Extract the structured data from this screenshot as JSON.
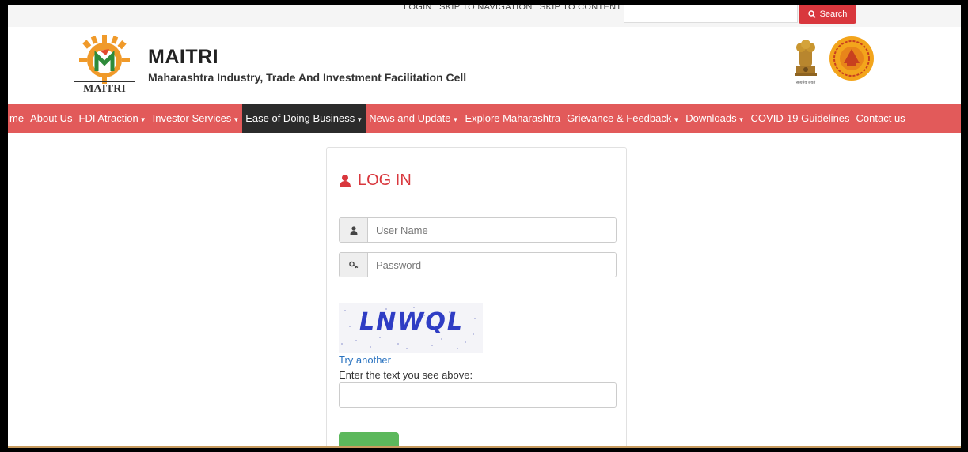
{
  "topbar": {
    "links": [
      "LOGIN",
      "SKIP TO NAVIGATION",
      "SKIP TO CONTENT"
    ],
    "search_label": "Search",
    "search_icon": "search-icon"
  },
  "header": {
    "title": "MAITRI",
    "subtitle": "Maharashtra Industry, Trade And Investment Facilitation Cell",
    "logo_text": "MAITRI",
    "emblem_text": "सत्यमेव जयते"
  },
  "nav": {
    "items": [
      {
        "label": "me",
        "dropdown": false
      },
      {
        "label": "About Us",
        "dropdown": false
      },
      {
        "label": "FDI Atraction",
        "dropdown": true
      },
      {
        "label": "Investor Services",
        "dropdown": true
      },
      {
        "label": "Ease of Doing Business",
        "dropdown": true,
        "active": true
      },
      {
        "label": "News and Update",
        "dropdown": true
      },
      {
        "label": "Explore Maharashtra",
        "dropdown": false
      },
      {
        "label": "Grievance & Feedback",
        "dropdown": true
      },
      {
        "label": "Downloads",
        "dropdown": true
      },
      {
        "label": "COVID-19 Guidelines",
        "dropdown": false
      },
      {
        "label": "Contact us",
        "dropdown": false
      }
    ]
  },
  "login": {
    "heading": "LOG IN",
    "username_placeholder": "User Name",
    "password_placeholder": "Password",
    "captcha_text": "LNWQL",
    "try_another": "Try another",
    "captcha_prompt": "Enter the text you see above:",
    "captcha_value": ""
  },
  "colors": {
    "accent": "#d9373d",
    "nav_bg": "#e25a5a",
    "nav_active": "#2b2b2b",
    "link": "#2a73c0",
    "button_green": "#5cb85c"
  }
}
